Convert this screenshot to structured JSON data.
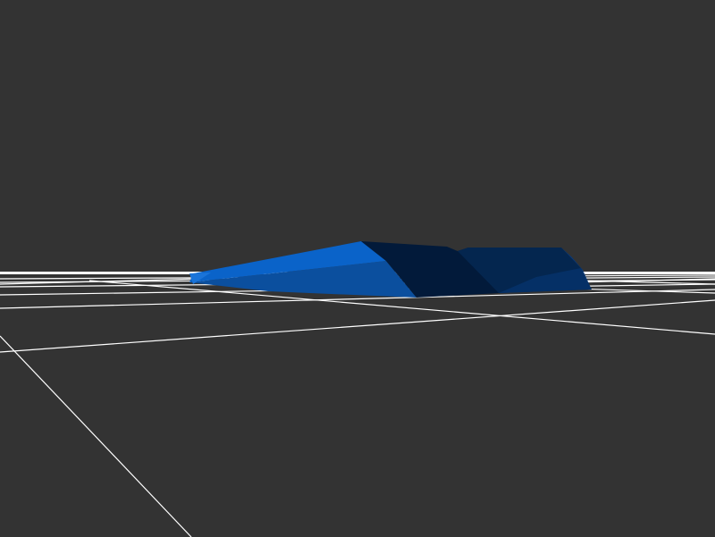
{
  "scene": {
    "background_color": "#333333",
    "grid_color": "#ffffff",
    "model_colors": {
      "lit_face": "#0a63c9",
      "mid_face": "#0a56ad",
      "lower_face": "#0b4f9e",
      "shadow_face": "#04264f",
      "dark_face": "#021a3a",
      "side_face": "#06387a"
    }
  }
}
